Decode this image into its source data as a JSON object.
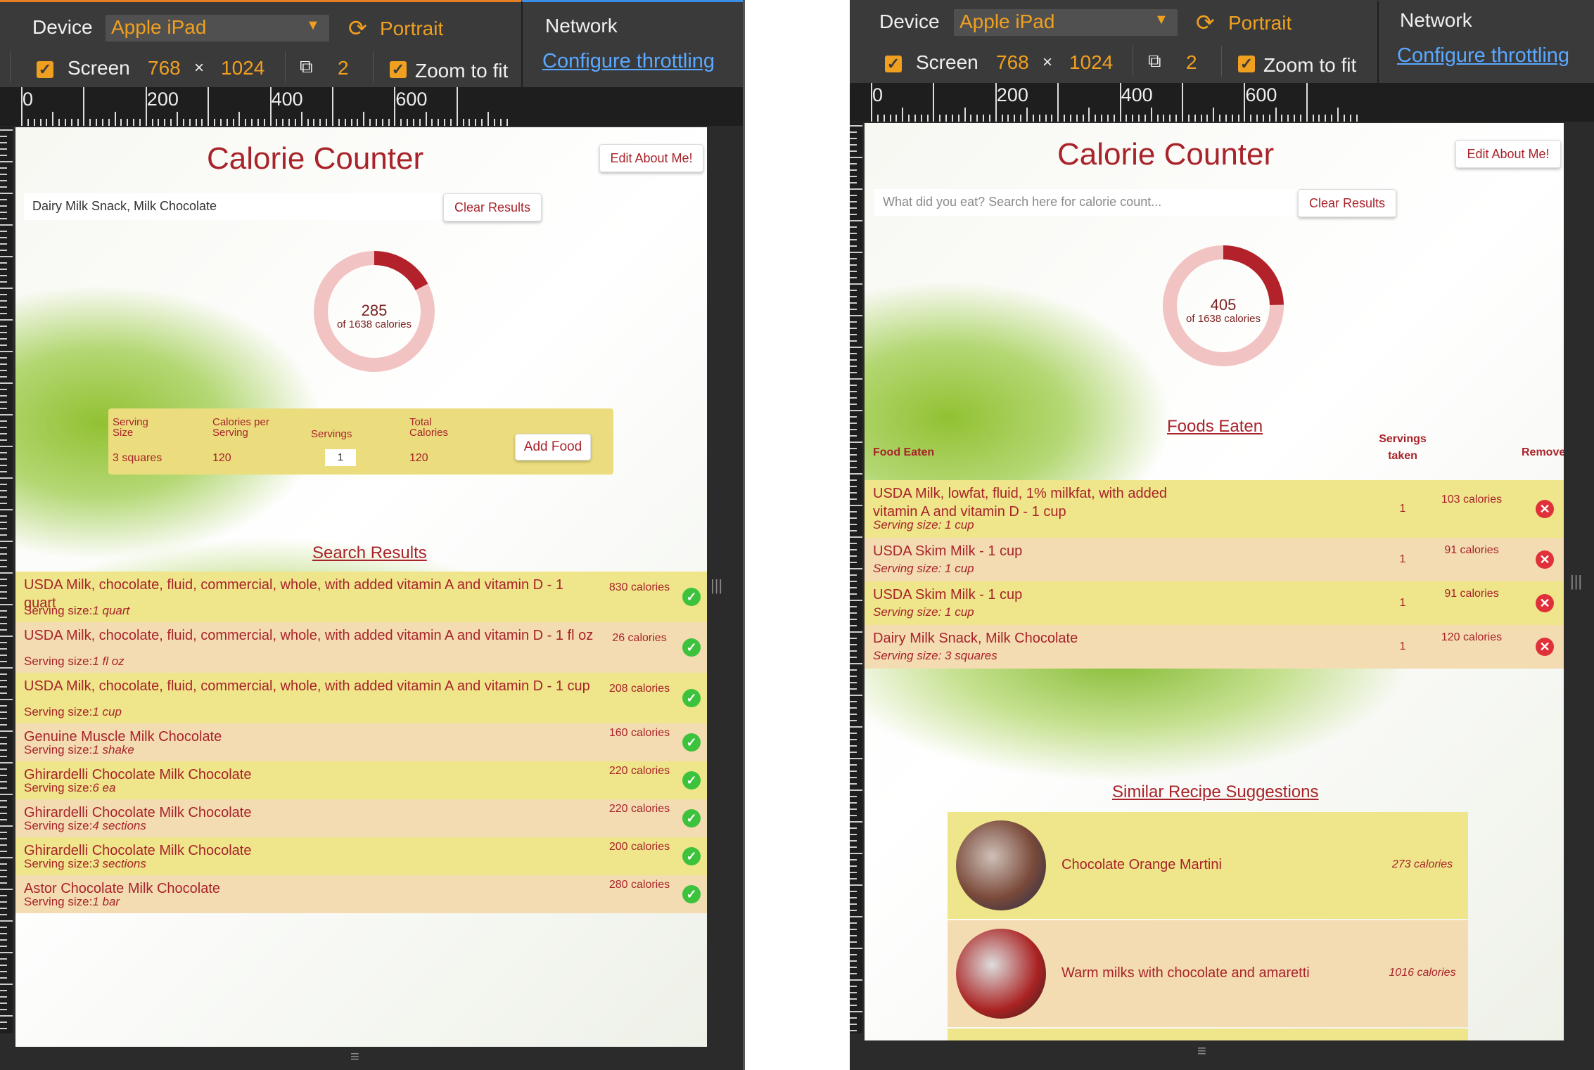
{
  "toolbar": {
    "device_label": "Device",
    "device_value": "Apple iPad",
    "orientation_label": "Portrait",
    "screen_label": "Screen",
    "width": "768",
    "times": "×",
    "height": "1024",
    "pixel_ratio": "2",
    "zoom_label": "Zoom to fit",
    "network_label": "Network",
    "throttle_link": "Configure throttling"
  },
  "ruler": {
    "labels": [
      "0",
      "200",
      "400",
      "600"
    ]
  },
  "app": {
    "title": "Calorie Counter",
    "edit_button": "Edit About Me!",
    "clear_button": "Clear Results",
    "calorie_goal_text": "of 1638 calories"
  },
  "left": {
    "search_value": "Dairy Milk Snack, Milk Chocolate",
    "calories_consumed": "285",
    "progress_fraction": 0.174,
    "add_panel": {
      "serving_size_header": "Serving Size",
      "calories_header": "Calories per Serving",
      "servings_header": "Servings",
      "total_header": "Total Calories",
      "serving_size": "3 squares",
      "calories_per_serving": "120",
      "servings_value": "1",
      "total_calories": "120",
      "add_button": "Add Food"
    },
    "results_heading": "Search Results",
    "results": [
      {
        "name": "USDA Milk, chocolate, fluid, commercial, whole, with added vitamin A and vitamin D - 1 quart",
        "serving": "1 quart",
        "calories": "830 calories"
      },
      {
        "name": "USDA Milk, chocolate, fluid, commercial, whole, with added vitamin A and vitamin D - 1 fl oz",
        "serving": "1 fl oz",
        "calories": "26 calories"
      },
      {
        "name": "USDA Milk, chocolate, fluid, commercial, whole, with added vitamin A and vitamin D - 1 cup",
        "serving": "1 cup",
        "calories": "208 calories"
      },
      {
        "name": "Genuine Muscle Milk Chocolate",
        "serving": "1 shake",
        "calories": "160 calories"
      },
      {
        "name": "Ghirardelli Chocolate Milk Chocolate",
        "serving": "6 ea",
        "calories": "220 calories"
      },
      {
        "name": "Ghirardelli Chocolate Milk Chocolate",
        "serving": "4 sections",
        "calories": "220 calories"
      },
      {
        "name": "Ghirardelli Chocolate Milk Chocolate",
        "serving": "3 sections",
        "calories": "200 calories"
      },
      {
        "name": "Astor Chocolate Milk Chocolate",
        "serving": "1 bar",
        "calories": "280 calories"
      }
    ],
    "serving_prefix": "Serving size:"
  },
  "right": {
    "search_placeholder": "What did you eat? Search here for calorie count...",
    "calories_consumed": "405",
    "progress_fraction": 0.247,
    "eaten_heading": "Foods Eaten",
    "col_food": "Food Eaten",
    "col_servings": "Servings taken",
    "col_remove": "Remove",
    "serving_prefix": "Serving size: ",
    "eaten": [
      {
        "name": "USDA Milk, lowfat, fluid, 1% milkfat, with added vitamin A and vitamin D - 1 cup",
        "serving": "1 cup",
        "servings": "1",
        "calories": "103 calories"
      },
      {
        "name": "USDA Skim Milk - 1 cup",
        "serving": "1 cup",
        "servings": "1",
        "calories": "91 calories"
      },
      {
        "name": "USDA Skim Milk - 1 cup",
        "serving": "1 cup",
        "servings": "1",
        "calories": "91 calories"
      },
      {
        "name": "Dairy Milk Snack, Milk Chocolate",
        "serving": "3 squares",
        "servings": "1",
        "calories": "120 calories"
      }
    ],
    "recipes_heading": "Similar Recipe Suggestions",
    "recipes": [
      {
        "name": "Chocolate Orange Martini",
        "calories": "273 calories"
      },
      {
        "name": "Warm milks with chocolate and amaretti",
        "calories": "1016 calories"
      }
    ]
  },
  "colors": {
    "accent": "#a8232a",
    "row_yellow": "#efe58a",
    "row_tan": "#f4dcb2",
    "donut_fill": "#b3222a",
    "donut_track": "#f0b8b8",
    "ok": "#3cc23c",
    "remove": "#e0303a"
  }
}
